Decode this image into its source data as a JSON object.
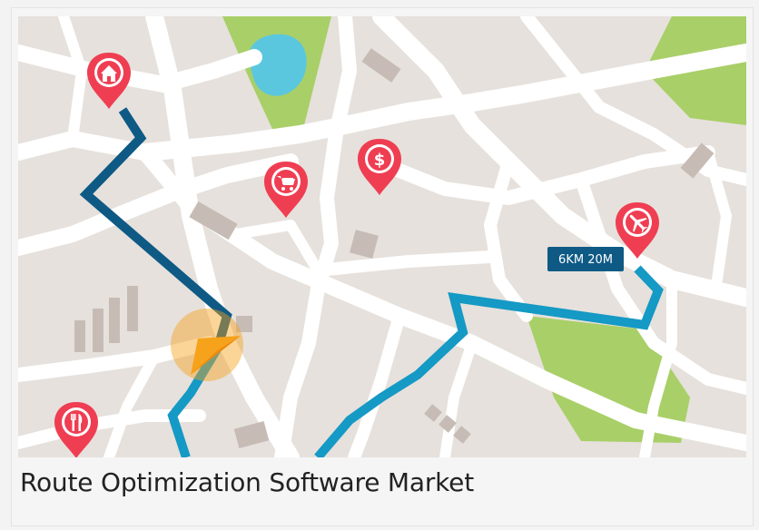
{
  "map": {
    "route_label": "6KM 20M",
    "colors": {
      "background": "#e6e1dc",
      "roads": "#ffffff",
      "parks": "#a9cf68",
      "water": "#5bc7df",
      "buildings": "#c7bcb5",
      "route_dark": "#0e5a85",
      "route_light": "#1599c5",
      "pin": "#ef3e52",
      "current_location": "#f7a21b",
      "label_bg": "#0e5a85"
    },
    "pins": [
      {
        "name": "home-pin",
        "icon": "home-icon"
      },
      {
        "name": "shopping-pin",
        "icon": "shopping-cart-icon"
      },
      {
        "name": "money-pin",
        "icon": "dollar-icon"
      },
      {
        "name": "airport-pin",
        "icon": "airplane-icon"
      },
      {
        "name": "restaurant-pin",
        "icon": "fork-knife-icon"
      }
    ]
  },
  "caption": {
    "title": "Route Optimization Software Market"
  }
}
